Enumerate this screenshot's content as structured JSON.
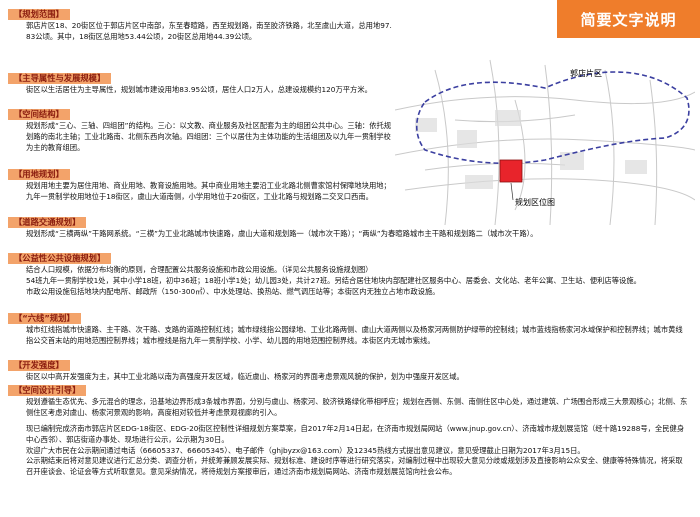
{
  "banner": "简要文字说明",
  "sections": [
    {
      "title": "【规划范围】",
      "body": [
        "郭店片区18、20街区位于郭店片区中南部，东至春暄路，西至规划路，南至胶济铁路，北至虞山大道，总用地97.83公顷。其中，18街区总用地53.44公顷，20街区总用地44.39公顷。"
      ]
    },
    {
      "title": "【主导属性与发展规模】",
      "body": [
        "街区以生活居住为主导属性，规划城市建设用地83.95公顷，居住人口2万人，总建设规模约120万平方米。"
      ]
    },
    {
      "title": "【空间结构】",
      "body": [
        "规划形成“三心、三轴、四组团”的结构。三心：以文教、商业服务及社区配套为主的组团公共中心。三轴：依托规划路的南北主轴；工业北路南、北侧东西向次轴。四组团：三个以居住为主体功能的生活组团及以九年一贯制学校为主的教育组团。"
      ]
    },
    {
      "title": "【用地规划】",
      "body": [
        "规划用地主要为居住用地、商业用地、教育设施用地。其中商业用地主要沿工业北路北侧曹家馆村保障地块用地；九年一贯制学校用地位于18街区，虞山大道南侧，小学用地位于20街区，工业北路与规划路二交叉口西南。"
      ]
    },
    {
      "title": "【道路交通规划】",
      "body": [
        "规划形成“三横两纵”干路网系统。“三横”为工业北路城市快速路，虞山大道和规划路一（城市次干路）；“两纵”为春暄路城市主干路和规划路二（城市次干路）。"
      ]
    },
    {
      "title": "【公益性公共设施规划】",
      "body": [
        "结合人口规模，依据分布均衡的原则，合理配置公共服务设施和市政公用设施。（详见公共服务设施规划图）",
        "54班九年一贯制学校1处，其中小学18班，初中36班；18班小学1处；幼儿园3处，共计27班。另结合居住地块内部配建社区服务中心、居委会、文化站、老年公寓、卫生站、便利店等设施。",
        "市政公用设施包括地块内配电所、邮政所（150-300㎡）、中水处理站、换热站、燃气调压站等；本街区内无独立占地市政设施。"
      ]
    },
    {
      "title": "【“六线”规划】",
      "body": [
        "城市红线指城市快速路、主干路、次干路、支路的道路控制红线；城市绿线指公园绿地、工业北路两侧、虞山大道两侧以及杨家河两侧防护绿带的控制线；城市蓝线指杨家河水域保护和控制界线；城市黄线指公交首末站的用地范围控制界线；城市橙线是指九年一贯制学校、小学、幼儿园的用地范围控制界线。本街区内无城市紫线。"
      ]
    },
    {
      "title": "【开发强度】",
      "body": [
        "街区以中高开发强度为主，其中工业北路以南为高强度开发区域，临近虞山、杨家河的界面考虑景观风貌的保护，划为中强度开发区域。"
      ]
    },
    {
      "title": "【空间设计引导】",
      "body": [
        "规划遵循生态优先、多元混合的理念，沿基地边界形成3条城市界面，分别与虞山、杨家河、胶济铁路绿化带相呼应；规划在西侧、东侧、南侧住区中心处，通过建筑、广场围合形成三大景观核心；北侧、东侧住区考虑对虞山、杨家河景观的影响，高度相对较低并考虑景观视廊的引入。"
      ]
    }
  ],
  "footer": [
    "现已编制完成济南市郭店片区EDG-18街区、EDG-20街区控制性详细规划方案草案，自2017年2月14日起，在济南市规划局网站（www.jnup.gov.cn）、济南城市规划展览馆（经十路19288号，全民健身中心西邻）、郭店街道办事处、现场进行公示，公示期为30日。",
    "欢迎广大市民在公示期间通过电话（66605337、66605345）、电子邮件（ghjbyzx@163.com）及12345热线方式提出意见建议，意见受理截止日期为2017年3月15日。",
    "公示期结束后将对意见建议进行汇总分类、调查分析，并统筹兼顾发展实际、规划标准、建设时序等进行研究落实，对编制过程中出现较大意见分歧或规划涉及直接影响公众安全、健康等特殊情况，将采取召开座谈会、论证会等方式听取意见。意见采纳情况，将待规划方案报审后，通过济南市规划局网站、济南市规划展览馆向社会公布。"
  ],
  "map": {
    "label_area": "郭店片区",
    "label_site": "规划区位图"
  },
  "colors": {
    "banner": "#ef7d2b",
    "header_bg": "#f3a36a",
    "header_text": "#8b1d0f",
    "site": "#e8242b"
  }
}
